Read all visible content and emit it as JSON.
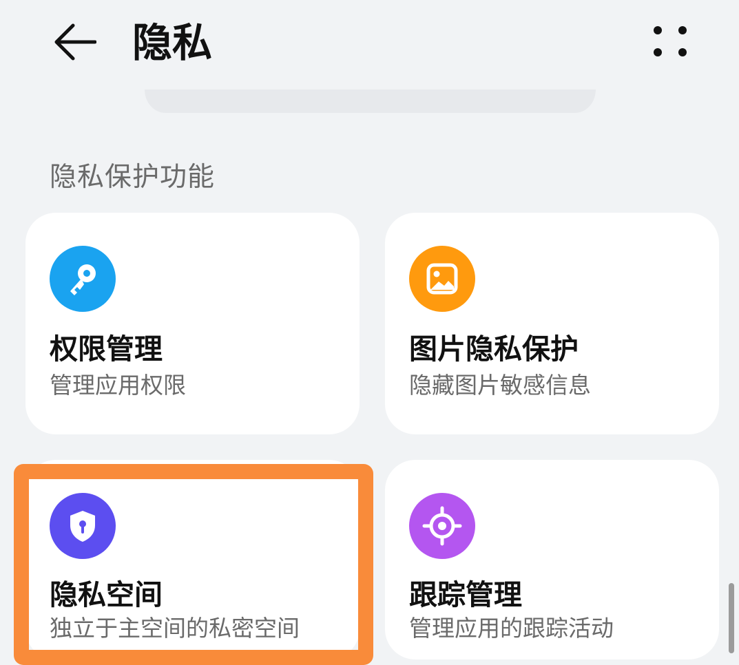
{
  "header": {
    "title": "隐私",
    "back_icon": "back-arrow-icon",
    "more_icon": "more-dots-icon"
  },
  "section": {
    "title": "隐私保护功能"
  },
  "cards": [
    {
      "title": "权限管理",
      "subtitle": "管理应用权限",
      "icon": "key-icon",
      "color": "#1aa3f0"
    },
    {
      "title": "图片隐私保护",
      "subtitle": "隐藏图片敏感信息",
      "icon": "image-icon",
      "color": "#ff9a0e"
    },
    {
      "title": "隐私空间",
      "subtitle": "独立于主空间的私密空间",
      "icon": "shield-lock-icon",
      "color": "#5c4ef0"
    },
    {
      "title": "跟踪管理",
      "subtitle": "管理应用的跟踪活动",
      "icon": "target-icon",
      "color": "#b456f0"
    }
  ],
  "colors": {
    "background": "#f1f3f5",
    "card": "#ffffff",
    "highlight": "#f98b3a"
  }
}
